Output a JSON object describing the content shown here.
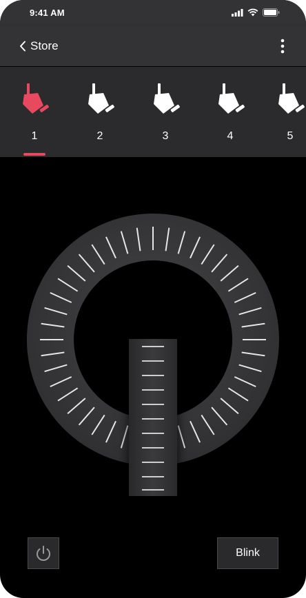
{
  "status_bar": {
    "time": "9:41 AM",
    "icons": [
      "signal-icon",
      "wifi-icon",
      "battery-icon"
    ]
  },
  "nav": {
    "back_label": "Store",
    "back_icon": "chevron-left-icon",
    "menu_icon": "more-vertical-icon"
  },
  "fixtures": [
    {
      "label": "1",
      "selected": true
    },
    {
      "label": "2",
      "selected": false
    },
    {
      "label": "3",
      "selected": false
    },
    {
      "label": "4",
      "selected": false
    },
    {
      "label": "5",
      "selected": false
    }
  ],
  "controls": {
    "power_icon": "power-icon",
    "blink_label": "Blink"
  },
  "colors": {
    "accent": "#e8495e",
    "header_bg": "#333336",
    "fixture_bar_bg": "#2b2b2e",
    "dial_ring": "#3a3a3d",
    "background": "#000000",
    "text": "#ffffff"
  }
}
